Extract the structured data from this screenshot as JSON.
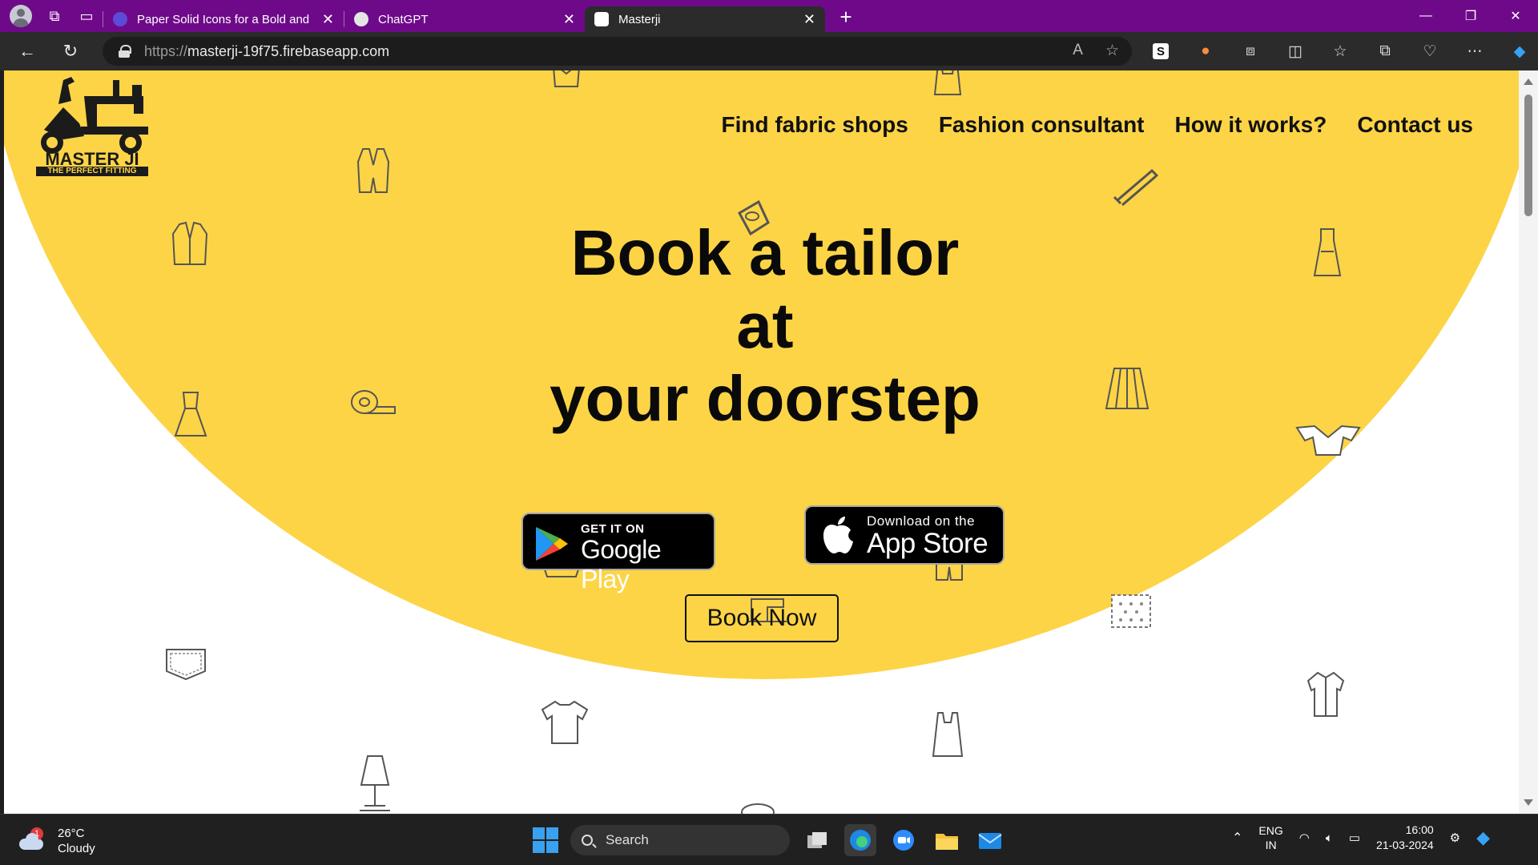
{
  "browser": {
    "tabs": [
      {
        "title": "Paper Solid Icons for a Bold and",
        "favicon_color": "#5b4bd6",
        "active": false
      },
      {
        "title": "ChatGPT",
        "favicon_color": "#3a3a3a",
        "active": false
      },
      {
        "title": "Masterji",
        "favicon_color": "#ffffff",
        "active": true
      }
    ],
    "url_protocol": "https://",
    "url_host": "masterji-19f75.firebaseapp.com"
  },
  "page": {
    "logo": {
      "name": "MASTER JI",
      "tagline": "THE PERFECT FITTING"
    },
    "nav": [
      "Find fabric shops",
      "Fashion consultant",
      "How it works?",
      "Contact us"
    ],
    "headline": {
      "line1": "Book a tailor",
      "line2": "at",
      "line3": "your doorstep"
    },
    "google_play": {
      "small": "GET IT ON",
      "big": "Google Play"
    },
    "app_store": {
      "small": "Download on the",
      "big": "App Store"
    },
    "book_button": "Book Now",
    "colors": {
      "hero": "#fdd446",
      "text": "#0a0a0a"
    }
  },
  "taskbar": {
    "weather": {
      "temp": "26°C",
      "condition": "Cloudy",
      "badge": "1"
    },
    "search_label": "Search",
    "lang": {
      "line1": "ENG",
      "line2": "IN"
    },
    "time": "16:00",
    "date": "21-03-2024"
  }
}
